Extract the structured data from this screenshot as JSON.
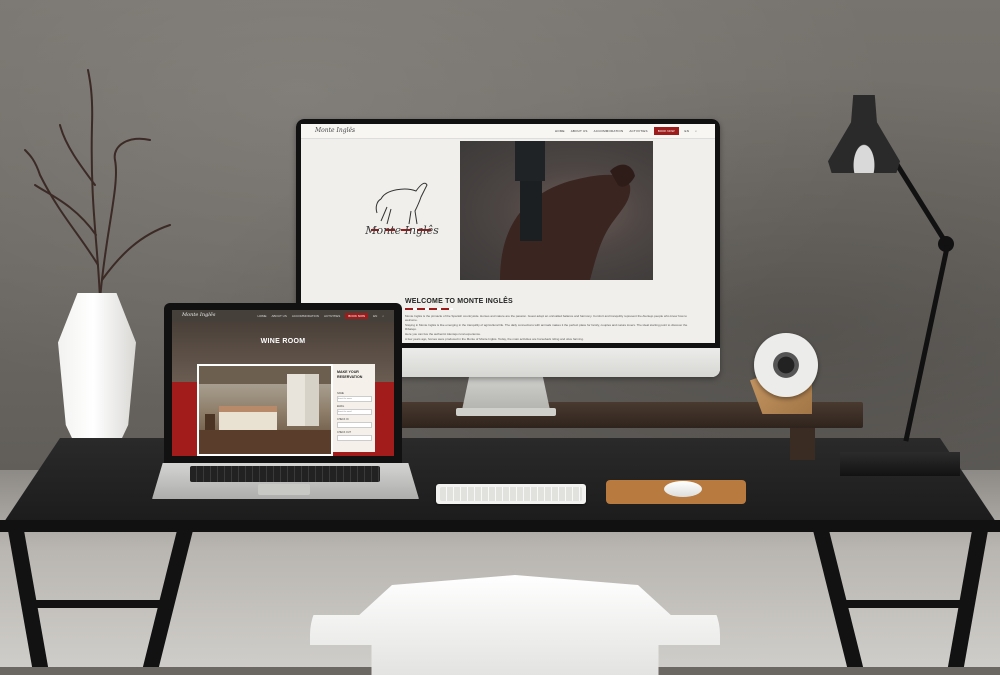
{
  "monitor_site": {
    "logo_small": "Monte Inglês",
    "nav_links": [
      "HOME",
      "ABOUT US",
      "ACCOMMODATION",
      "ACTIVITIES"
    ],
    "book_now": "BOOK NOW",
    "lang": "EN",
    "brand_name": "Monte Inglês",
    "welcome_heading": "WELCOME TO MONTE INGLÊS",
    "paragraphs": [
      "Monte Inglês is the pinnacle of the Spanish countryside. Horses and nature are the passion. Guest adopt an unrivalled balance and harmony. Comfort and tranquility represent the Alentejo people who know how to welcome.",
      "Staying in Monte Inglês is like emerging in the tranquility of agricultural life. The daily connections with animals makes it the perfect place for family, couples and nature lovers. The ideal starting point to discover the Ribatejo.",
      "Here you can live the authentic Alentejo rural experience.",
      "A few years ago, horses were produced in the Monte of Monte Inglês. Today, the main activities are horseback riding and olive farming."
    ]
  },
  "laptop_site": {
    "logo_small": "Monte Inglês",
    "nav_links": [
      "HOME",
      "ABOUT US",
      "ACCOMMODATION",
      "ACTIVITIES"
    ],
    "book_now": "BOOK NOW",
    "lang": "EN",
    "page_title": "WINE ROOM",
    "form_title": "MAKE YOUR RESERVATION",
    "fields": [
      {
        "label": "NAME",
        "placeholder": "Insert the name"
      },
      {
        "label": "EMAIL",
        "placeholder": "Insert the email"
      },
      {
        "label": "CHECK IN",
        "placeholder": ""
      },
      {
        "label": "CHECK OUT",
        "placeholder": ""
      }
    ]
  },
  "icons": {
    "apple": "apple-logo-icon",
    "horse": "horse-logo-icon"
  },
  "colors": {
    "brand_red": "#9e1b1b",
    "site_bg": "#f0efeb"
  }
}
